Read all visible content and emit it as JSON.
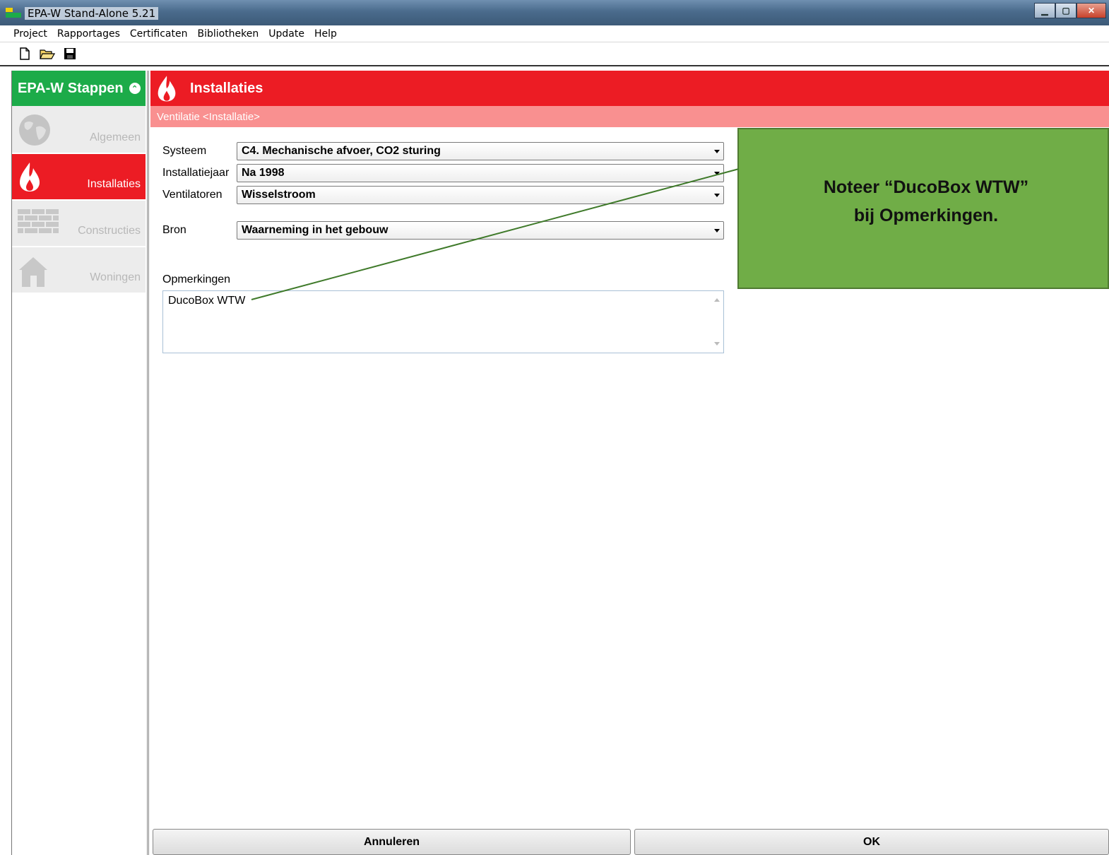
{
  "window": {
    "title": "EPA-W Stand-Alone 5.21"
  },
  "menu": [
    "Project",
    "Rapportages",
    "Certificaten",
    "Bibliotheken",
    "Update",
    "Help"
  ],
  "toolbar": {
    "icons": [
      "new-document-icon",
      "open-folder-icon",
      "save-disk-icon"
    ]
  },
  "steps": {
    "title": "EPA-W Stappen",
    "items": [
      {
        "label": "Algemeen",
        "icon": "globe-icon",
        "active": false
      },
      {
        "label": "Installaties",
        "icon": "flame-icon",
        "active": true
      },
      {
        "label": "Constructies",
        "icon": "brick-wall-icon",
        "active": false
      },
      {
        "label": "Woningen",
        "icon": "house-icon",
        "active": false
      }
    ]
  },
  "panel": {
    "title": "Installaties",
    "subtitle": "Ventilatie <Installatie>"
  },
  "form": {
    "systeem": {
      "label": "Systeem",
      "value": "C4. Mechanische afvoer, CO2 sturing"
    },
    "installatiejaar": {
      "label": "Installatiejaar",
      "value": "Na 1998"
    },
    "ventilatoren": {
      "label": "Ventilatoren",
      "value": "Wisselstroom"
    },
    "bron": {
      "label": "Bron",
      "value": "Waarneming in het gebouw"
    },
    "opmerkingen": {
      "label": "Opmerkingen",
      "value": "DucoBox WTW"
    }
  },
  "callout": {
    "line1": "Noteer “DucoBox WTW”",
    "line2": "bij Opmerkingen."
  },
  "buttons": {
    "cancel": "Annuleren",
    "ok": "OK"
  },
  "colors": {
    "green": "#1cab49",
    "red": "#ec1c24",
    "pink": "#f99090",
    "callout": "#70ad47"
  }
}
